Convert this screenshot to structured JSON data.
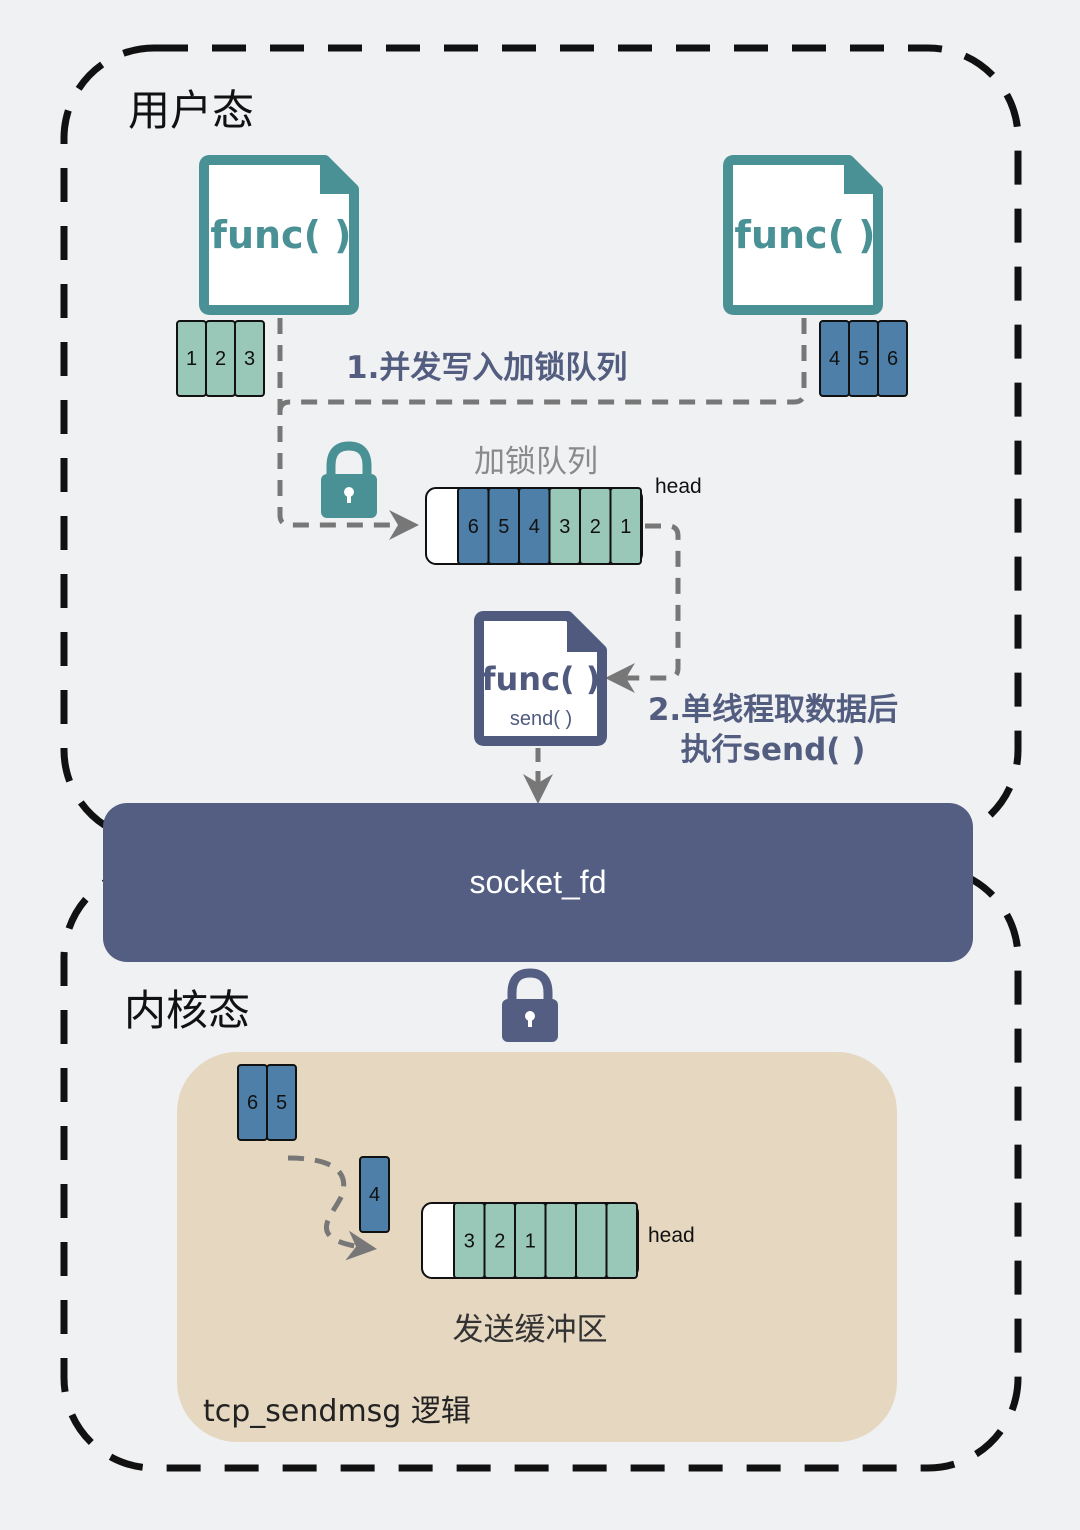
{
  "colors": {
    "background": "#f0f1f3",
    "teal": "#4a9196",
    "teal_cell": "#99c8b9",
    "blue_cell": "#4e7fa8",
    "navy": "#545e82",
    "beige": "#e6d7c1",
    "dash": "#777777",
    "border": "#111111"
  },
  "icons": [
    "document-icon",
    "lock-icon",
    "arrow-icon"
  ],
  "user_space": {
    "label": "用户态",
    "producer_left": {
      "func_label": "func( )",
      "items": [
        "1",
        "2",
        "3"
      ]
    },
    "producer_right": {
      "func_label": "func( )",
      "items": [
        "4",
        "5",
        "6"
      ]
    },
    "step1_label": "1.并发写入加锁队列",
    "locked_queue": {
      "title": "加锁队列",
      "items": [
        {
          "text": "6",
          "kind": "blue"
        },
        {
          "text": "5",
          "kind": "blue"
        },
        {
          "text": "4",
          "kind": "blue"
        },
        {
          "text": "3",
          "kind": "teal"
        },
        {
          "text": "2",
          "kind": "teal"
        },
        {
          "text": "1",
          "kind": "teal"
        }
      ],
      "head_label": "head"
    },
    "consumer": {
      "func_label": "func( )",
      "sub_label": "send( )"
    },
    "step2_label_line1": "2.单线程取数据后",
    "step2_label_line2": "执行send( )"
  },
  "socket": {
    "label": "socket_fd"
  },
  "kernel_space": {
    "label": "内核态",
    "pending_items": [
      "6",
      "5"
    ],
    "moving_item": "4",
    "send_buffer": {
      "items": [
        {
          "text": "3",
          "kind": "teal"
        },
        {
          "text": "2",
          "kind": "teal"
        },
        {
          "text": "1",
          "kind": "teal"
        },
        {
          "text": "",
          "kind": "teal"
        },
        {
          "text": "",
          "kind": "teal"
        },
        {
          "text": "",
          "kind": "teal"
        }
      ],
      "head_label": "head",
      "title": "发送缓冲区"
    },
    "logic_label": "tcp_sendmsg 逻辑"
  }
}
